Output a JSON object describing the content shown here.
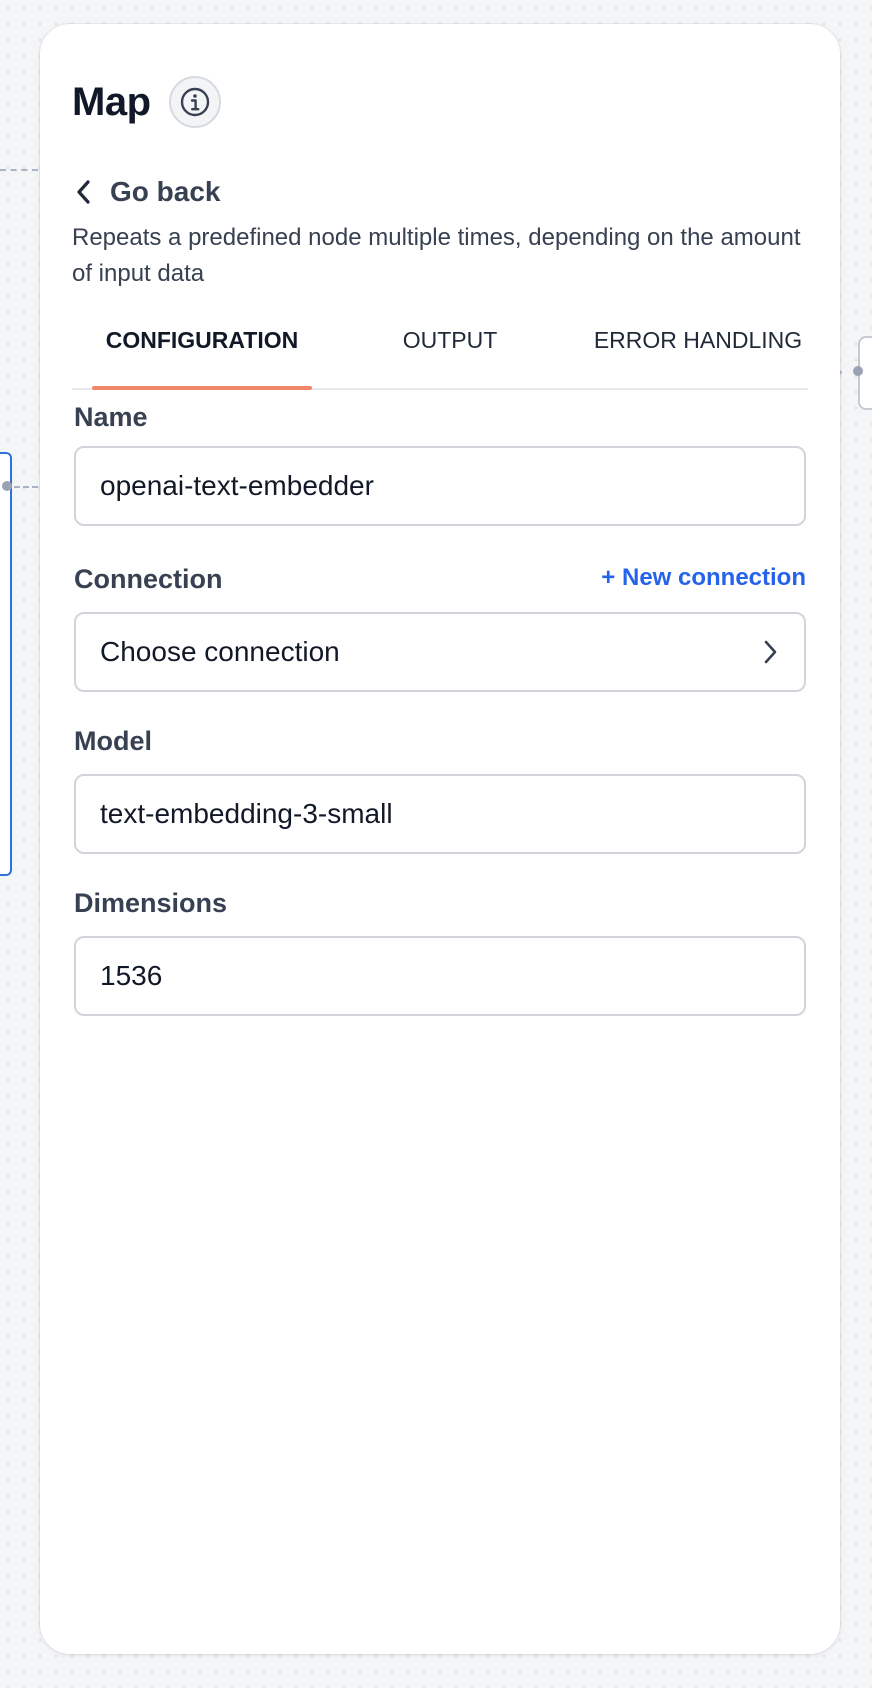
{
  "panel": {
    "title": "Map",
    "go_back_label": "Go back",
    "description": "Repeats a predefined node multiple times, depending on the amount of input data"
  },
  "tabs": [
    {
      "label": "CONFIGURATION",
      "active": true
    },
    {
      "label": "OUTPUT",
      "active": false
    },
    {
      "label": "ERROR HANDLING",
      "active": false
    }
  ],
  "form": {
    "name": {
      "label": "Name",
      "value": "openai-text-embedder"
    },
    "connection": {
      "label": "Connection",
      "value": "Choose connection",
      "new_label": "+ New connection"
    },
    "model": {
      "label": "Model",
      "value": "text-embedding-3-small"
    },
    "dimensions": {
      "label": "Dimensions",
      "value": "1536"
    }
  },
  "colors": {
    "accent_tab": "#f0876a",
    "link": "#2563eb",
    "canvas_node_border": "#2f6fe0"
  },
  "icons": {
    "info": "info-icon",
    "back": "chevron-left-icon",
    "select": "chevron-right-icon"
  }
}
